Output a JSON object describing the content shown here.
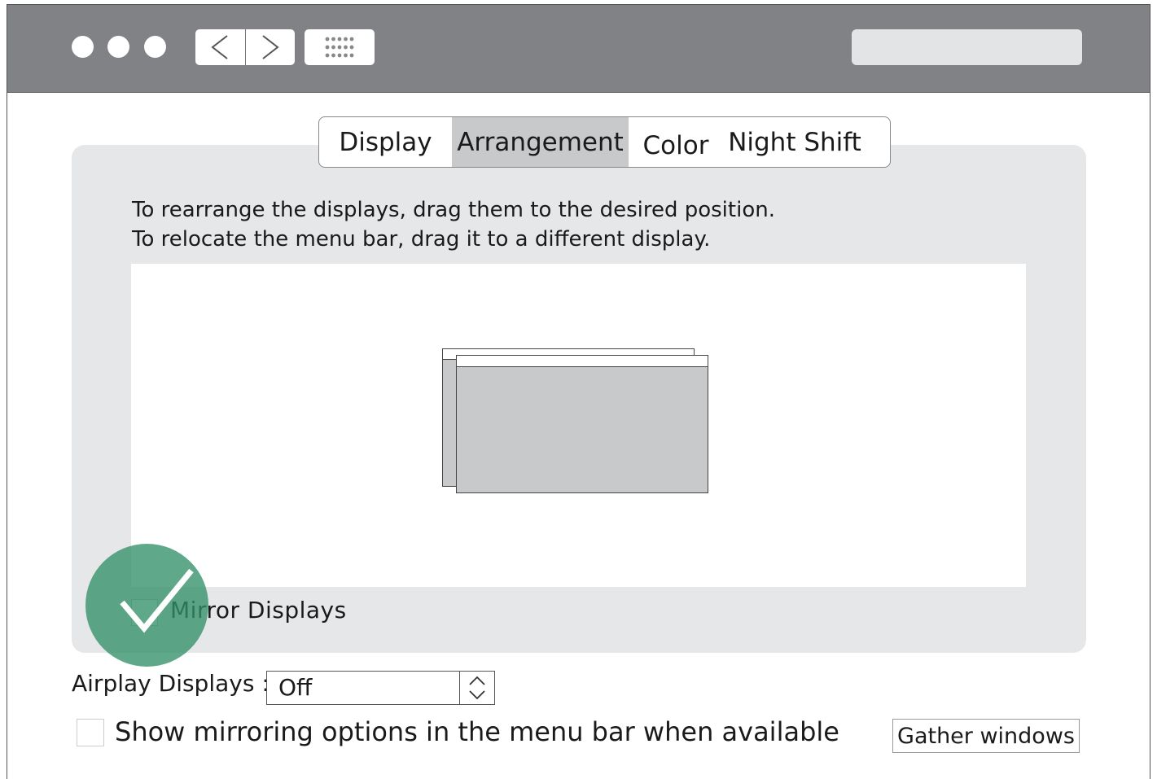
{
  "tabs": [
    {
      "label": "Display",
      "active": false
    },
    {
      "label": "Arrangement",
      "active": true
    },
    {
      "label": "Color",
      "active": false
    },
    {
      "label": "Night Shift",
      "active": false
    }
  ],
  "instructions": {
    "line1": "To rearrange the displays, drag them to the desired position.",
    "line2": "To relocate the menu bar, drag it to a different display."
  },
  "mirror": {
    "label": "Mirror Displays",
    "checked": true
  },
  "airplay": {
    "label": "Airplay Displays :",
    "value": "Off"
  },
  "show_mirroring": {
    "label": "Show mirroring options in the menu bar when available",
    "checked": false
  },
  "gather_button": {
    "label": "Gather windows"
  },
  "colors": {
    "titlebar": "#818285",
    "panel": "#e6e7e8",
    "active_tab": "#c8c9ca",
    "check_badge": "#32916a"
  },
  "icons": {
    "traffic_lights": [
      "close-icon",
      "minimize-icon",
      "zoom-icon"
    ],
    "back": "chevron-left-icon",
    "forward": "chevron-right-icon",
    "grid": "grid-dots-icon",
    "stepper": "up-down-arrows-icon",
    "badge": "checkmark-icon"
  }
}
